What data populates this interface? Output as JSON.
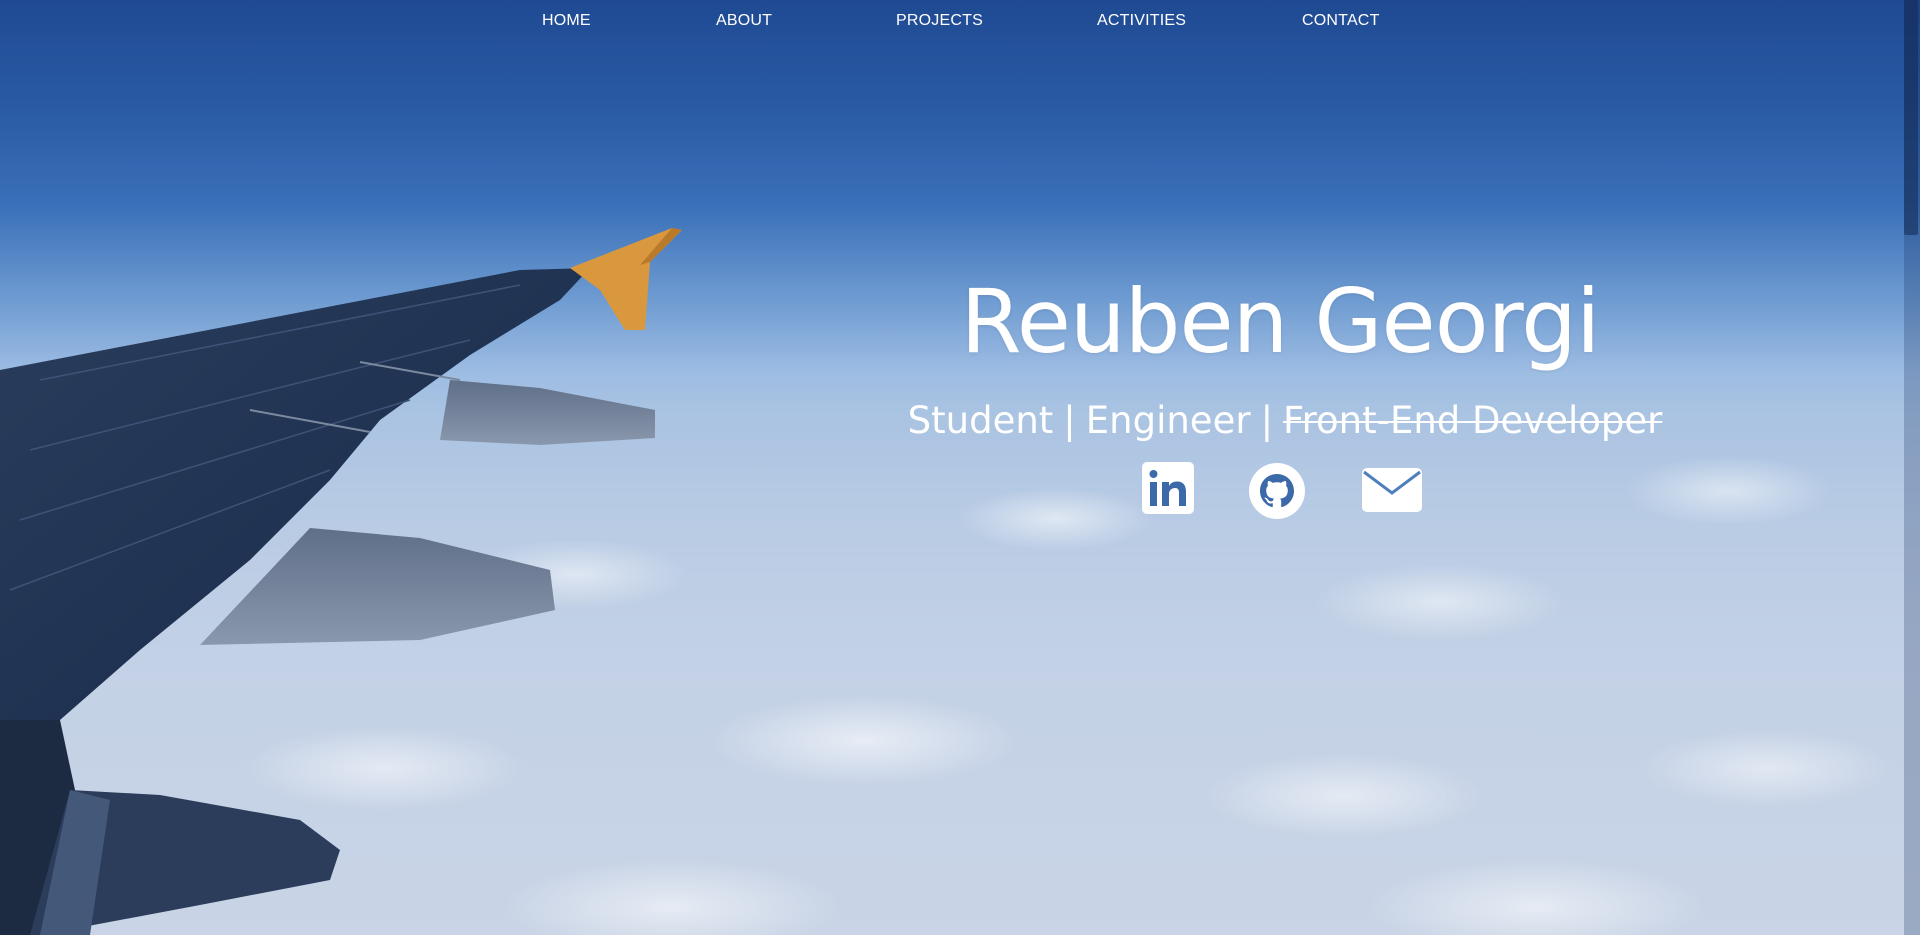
{
  "nav": {
    "items": [
      {
        "label": "HOME"
      },
      {
        "label": "ABOUT"
      },
      {
        "label": "PROJECTS"
      },
      {
        "label": "ACTIVITIES"
      },
      {
        "label": "CONTACT"
      }
    ]
  },
  "hero": {
    "name": "Reuben Georgi",
    "roles": [
      "Student",
      "Engineer",
      "Front-End Developer"
    ],
    "separator": "|",
    "struck_role": "Front-End Developer"
  },
  "socials": [
    {
      "icon": "linkedin-icon"
    },
    {
      "icon": "github-icon"
    },
    {
      "icon": "email-icon"
    }
  ],
  "colors": {
    "text": "#ffffff",
    "sky_top": "#1f4a93",
    "sky_mid": "#6e9bd1",
    "clouds": "#c9d4e6"
  }
}
